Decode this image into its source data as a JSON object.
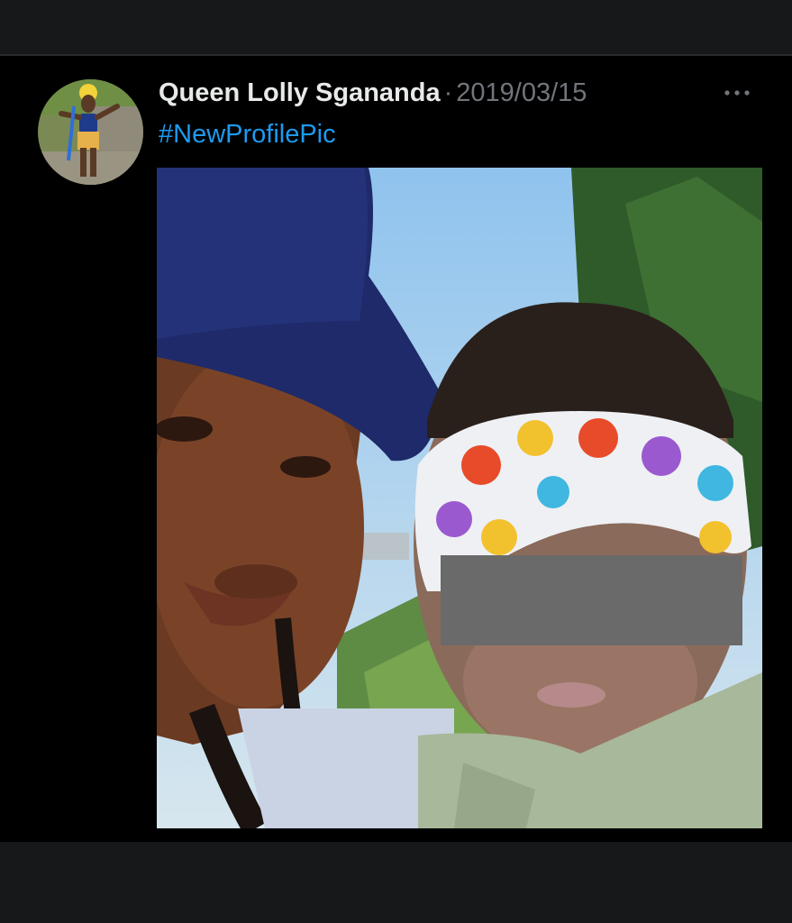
{
  "tweet": {
    "author_name": "Queen Lolly Sgananda",
    "separator": "·",
    "date": "2019/03/15",
    "text": "#NewProfilePic",
    "more_icon": "more-horizontal-icon"
  },
  "colors": {
    "background": "#000000",
    "chrome_bar": "#17181a",
    "name_text": "#e7e9ea",
    "muted_text": "#71767b",
    "link": "#1d9bf0"
  }
}
